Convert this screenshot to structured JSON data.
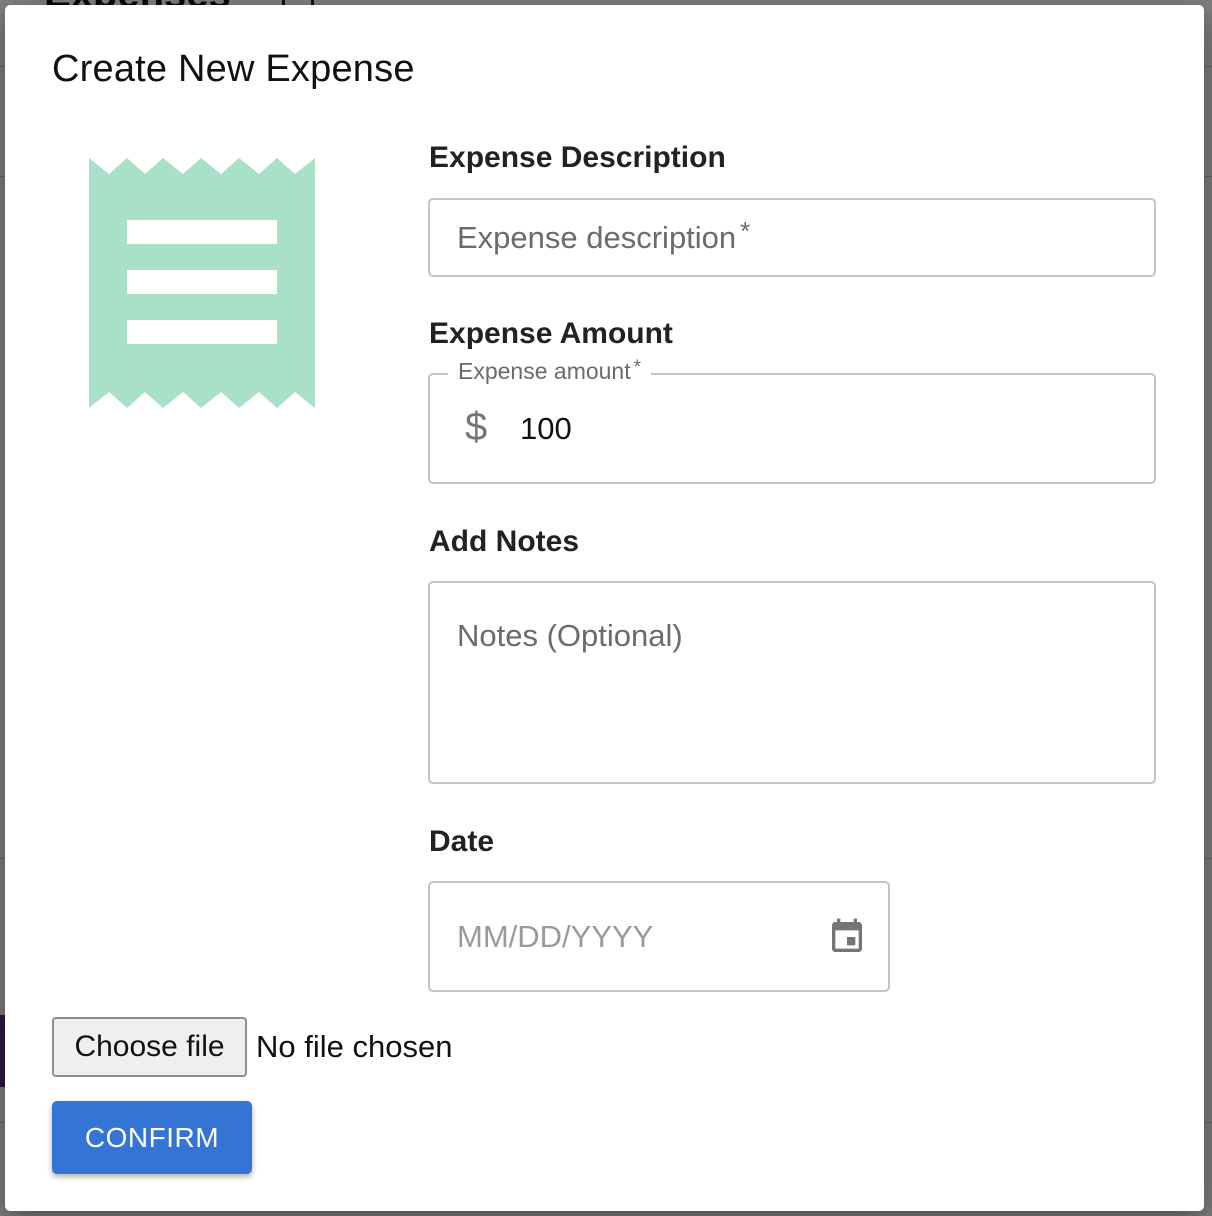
{
  "background": {
    "page_title": "Expenses"
  },
  "modal": {
    "title": "Create New Expense",
    "illustration": "receipt-icon",
    "description": {
      "label": "Expense Description",
      "placeholder": "Expense description",
      "required_mark": "*",
      "value": ""
    },
    "amount": {
      "label": "Expense Amount",
      "floating_label": "Expense amount",
      "required_mark": "*",
      "currency_symbol": "$",
      "value": "100"
    },
    "notes": {
      "label": "Add Notes",
      "placeholder": "Notes (Optional)",
      "value": ""
    },
    "date": {
      "label": "Date",
      "placeholder": "MM/DD/YYYY",
      "icon": "calendar-icon",
      "value": ""
    },
    "file": {
      "button_label": "Choose file",
      "status": "No file chosen"
    },
    "confirm_label": "CONFIRM"
  },
  "colors": {
    "accent": "#3474d4",
    "receipt": "#a8e0c8",
    "border": "#c4c4c4",
    "placeholder": "#6b6b6b"
  }
}
